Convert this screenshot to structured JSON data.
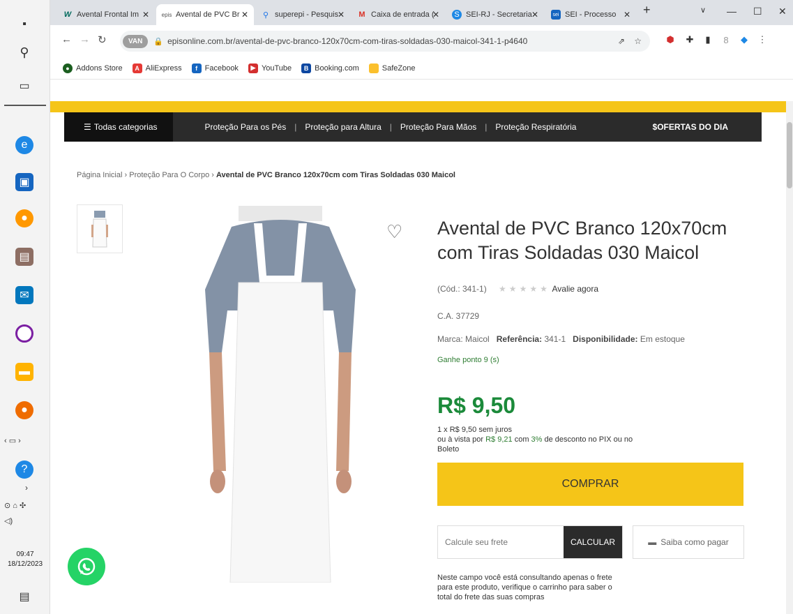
{
  "taskbar": {
    "time": "09:47",
    "date": "18/12/2023"
  },
  "tabs": [
    {
      "title": "Avental Frontal Im"
    },
    {
      "title": "Avental de PVC Br"
    },
    {
      "title": "superepi - Pesquis"
    },
    {
      "title": "Caixa de entrada ("
    },
    {
      "title": "SEI-RJ - Secretaria"
    },
    {
      "title": "SEI - Processo"
    }
  ],
  "address": {
    "pill": "VAN",
    "url": "episonline.com.br/avental-de-pvc-branco-120x70cm-com-tiras-soldadas-030-maicol-341-1-p4640"
  },
  "bookmarks": [
    {
      "label": "Addons Store",
      "color": "#1b5e20"
    },
    {
      "label": "AliExpress",
      "color": "#e53935"
    },
    {
      "label": "Facebook",
      "color": "#1565c0"
    },
    {
      "label": "YouTube",
      "color": "#d32f2f"
    },
    {
      "label": "Booking.com",
      "color": "#0d47a1"
    },
    {
      "label": "SafeZone",
      "color": "#fbc02d"
    }
  ],
  "nav": {
    "all_categories": "Todas categorias",
    "items": [
      "Proteção Para os Pés",
      "Proteção para Altura",
      "Proteção Para Mãos",
      "Proteção Respiratória"
    ],
    "offers": "OFERTAS DO DIA"
  },
  "breadcrumb": {
    "home": "Página Inicial",
    "category": "Proteção Para O Corpo",
    "current": "Avental de PVC Branco 120x70cm com Tiras Soldadas 030 Maicol"
  },
  "product": {
    "title": "Avental de PVC Branco 120x70cm com Tiras Soldadas 030 Maicol",
    "code": "(Cód.: 341-1)",
    "rating_label": "Avalie agora",
    "ca": "C.A. 37729",
    "brand_label": "Marca:",
    "brand": "Maicol",
    "reference_label": "Referência:",
    "reference": "341-1",
    "availability_label": "Disponibilidade:",
    "availability": "Em estoque",
    "points": "Ganhe ponto 9 (s)",
    "price": "R$ 9,50",
    "installments": "1 x R$ 9,50 sem juros",
    "cash_prefix": "ou à vista por",
    "cash_price": "R$ 9,21",
    "cash_mid": "com",
    "cash_discount": "3%",
    "cash_suffix": "de desconto no PIX ou no Boleto",
    "buy_label": "COMPRAR",
    "freight_placeholder": "Calcule seu frete",
    "calc_label": "CALCULAR",
    "pay_label": "Saiba como pagar",
    "freight_note": "Neste campo você está consultando apenas o frete para este produto, verifique o carrinho para saber o total do frete das suas compras"
  },
  "colors": {
    "accent": "#f5c518",
    "price": "#1b8a3a",
    "nav_bg": "#2b2b2b"
  }
}
